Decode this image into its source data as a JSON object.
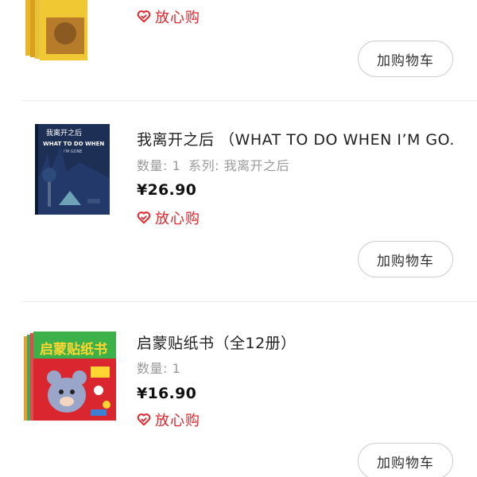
{
  "items": [
    {
      "badge": "放心购",
      "cart_button": "加购物车"
    },
    {
      "title": "我离开之后 （WHAT TO DO WHEN I’M GO...",
      "quantity": "数量: 1",
      "series": "系列: 我离开之后",
      "price": "¥26.90",
      "badge": "放心购",
      "cart_button": "加购物车",
      "cover_title_cn": "我离开之后",
      "cover_title_en": "WHAT TO DO WHEN",
      "cover_subtitle": "I'M GONE"
    },
    {
      "title": "启蒙贴纸书（全12册）",
      "quantity": "数量: 1",
      "price": "¥16.90",
      "badge": "放心购",
      "cart_button": "加购物车",
      "cover_title_cn": "启蒙贴纸书"
    }
  ],
  "colors": {
    "accent_red": "#e4252c",
    "text_dark": "#222222",
    "text_gray": "#9a9a9a",
    "divider": "#ececec"
  },
  "icons": {
    "badge_icon": "heart-check-icon"
  }
}
